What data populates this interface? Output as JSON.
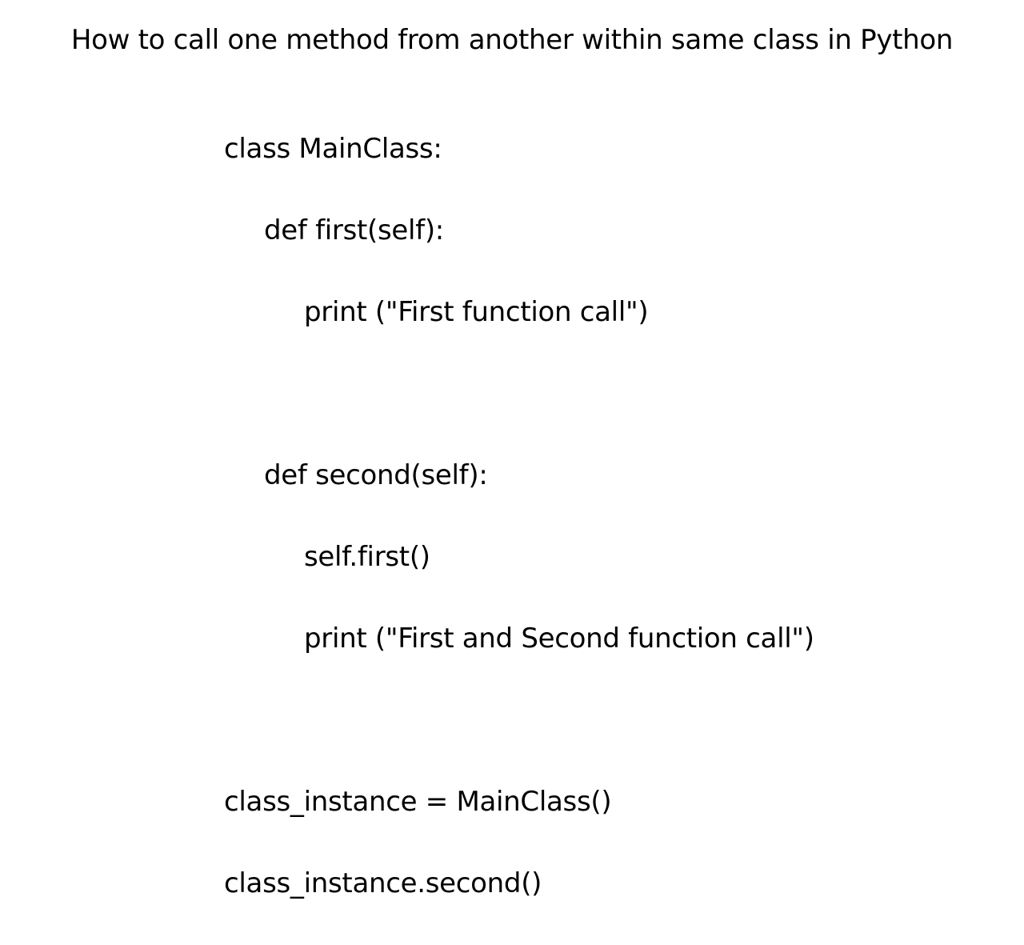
{
  "title": "How to call one method from another within same class in Python",
  "code": {
    "line1": "class MainClass:",
    "line2": "def first(self):",
    "line3": "print (\"First function call\")",
    "line4": "def second(self):",
    "line5": "self.first()",
    "line6": "print (\"First and Second function call\")",
    "line7": "class_instance = MainClass()",
    "line8": "class_instance.second()"
  }
}
